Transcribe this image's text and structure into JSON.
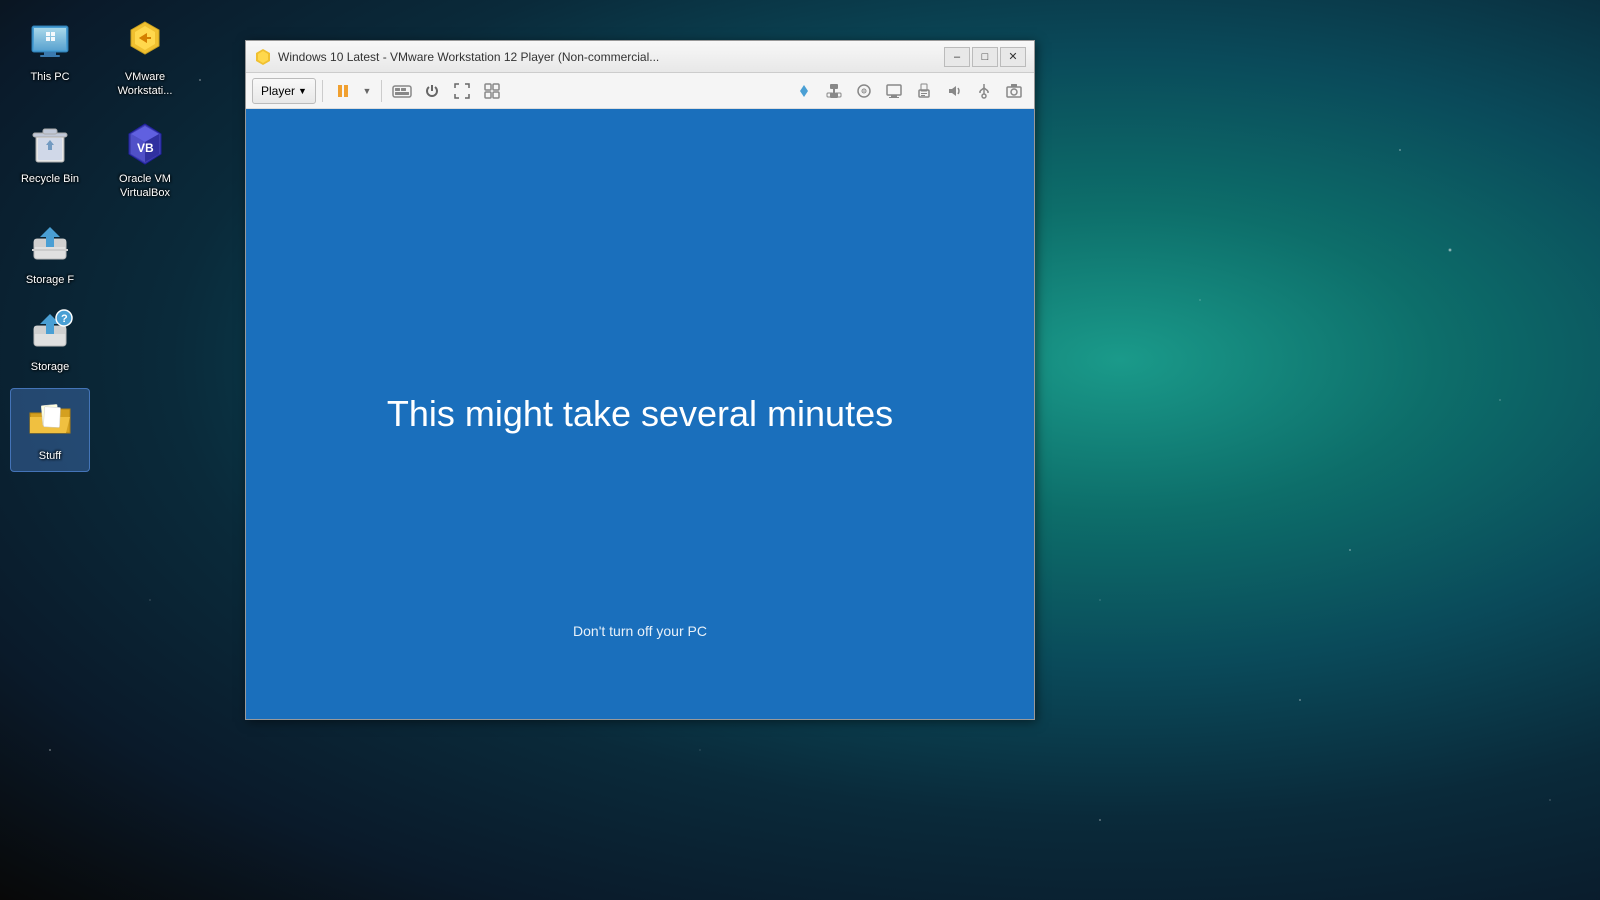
{
  "desktop": {
    "icons": [
      {
        "id": "this-pc",
        "label": "This PC",
        "col": 0,
        "row": 0
      },
      {
        "id": "vmware-workstation",
        "label": "VMware Workstati...",
        "col": 1,
        "row": 0
      },
      {
        "id": "recycle-bin",
        "label": "Recycle Bin",
        "col": 0,
        "row": 1
      },
      {
        "id": "oracle-vm-virtualbox",
        "label": "Oracle VM VirtualBox",
        "col": 1,
        "row": 1
      },
      {
        "id": "storage-f",
        "label": "Storage F",
        "col": 0,
        "row": 2
      },
      {
        "id": "storage",
        "label": "Storage",
        "col": 0,
        "row": 3
      },
      {
        "id": "stuff",
        "label": "Stuff",
        "col": 0,
        "row": 4,
        "selected": true
      }
    ]
  },
  "vmware_window": {
    "title": "Windows 10 Latest - VMware Workstation 12 Player (Non-commercial...",
    "toolbar": {
      "player_button": "Player",
      "icons": [
        "pause",
        "dropdown",
        "send-ctrl-alt-del",
        "power",
        "fullscreen",
        "unity"
      ]
    },
    "vm_screen": {
      "main_text": "This might take several minutes",
      "sub_text": "Don't turn off your PC"
    }
  }
}
